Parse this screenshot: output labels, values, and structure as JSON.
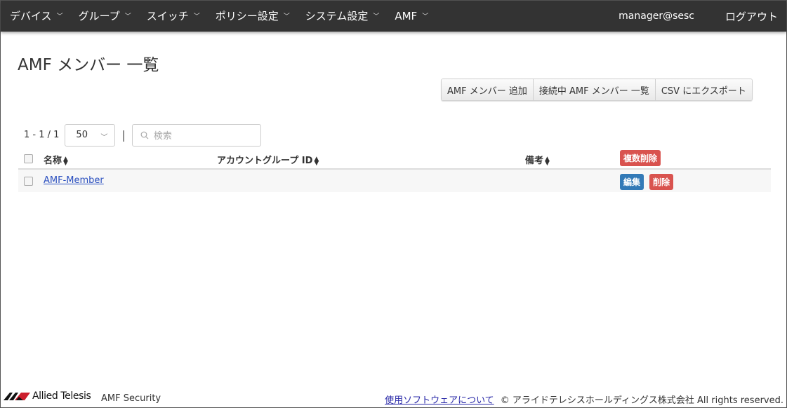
{
  "nav": {
    "items": [
      {
        "label": "デバイス"
      },
      {
        "label": "グループ"
      },
      {
        "label": "スイッチ"
      },
      {
        "label": "ポリシー設定"
      },
      {
        "label": "システム設定"
      },
      {
        "label": "AMF"
      }
    ],
    "user": "manager@sesc",
    "logout": "ログアウト"
  },
  "page": {
    "title": "AMF メンバー 一覧"
  },
  "toolbar": {
    "add": "AMF メンバー 追加",
    "connected": "接続中 AMF メンバー 一覧",
    "export": "CSV にエクスポート"
  },
  "pager": {
    "count": "1 - 1 / 1",
    "per_page": "50",
    "separator": "|",
    "search_placeholder": "検索"
  },
  "table": {
    "headers": {
      "name": "名称",
      "account_group": "アカウントグループ ID",
      "note": "備考"
    },
    "bulk_delete": "複数削除",
    "rows": [
      {
        "name": "AMF-Member",
        "account_group": "",
        "note": "",
        "edit": "編集",
        "delete": "削除"
      }
    ]
  },
  "footer": {
    "logo_text": "Allied Telesis",
    "product": "AMF Security",
    "about_link": "使用ソフトウェアについて",
    "copyright": "© アライドテレシスホールディングス株式会社 All rights reserved."
  },
  "colors": {
    "navbar": "#333333",
    "danger": "#d9534f",
    "primary": "#337ab7"
  }
}
